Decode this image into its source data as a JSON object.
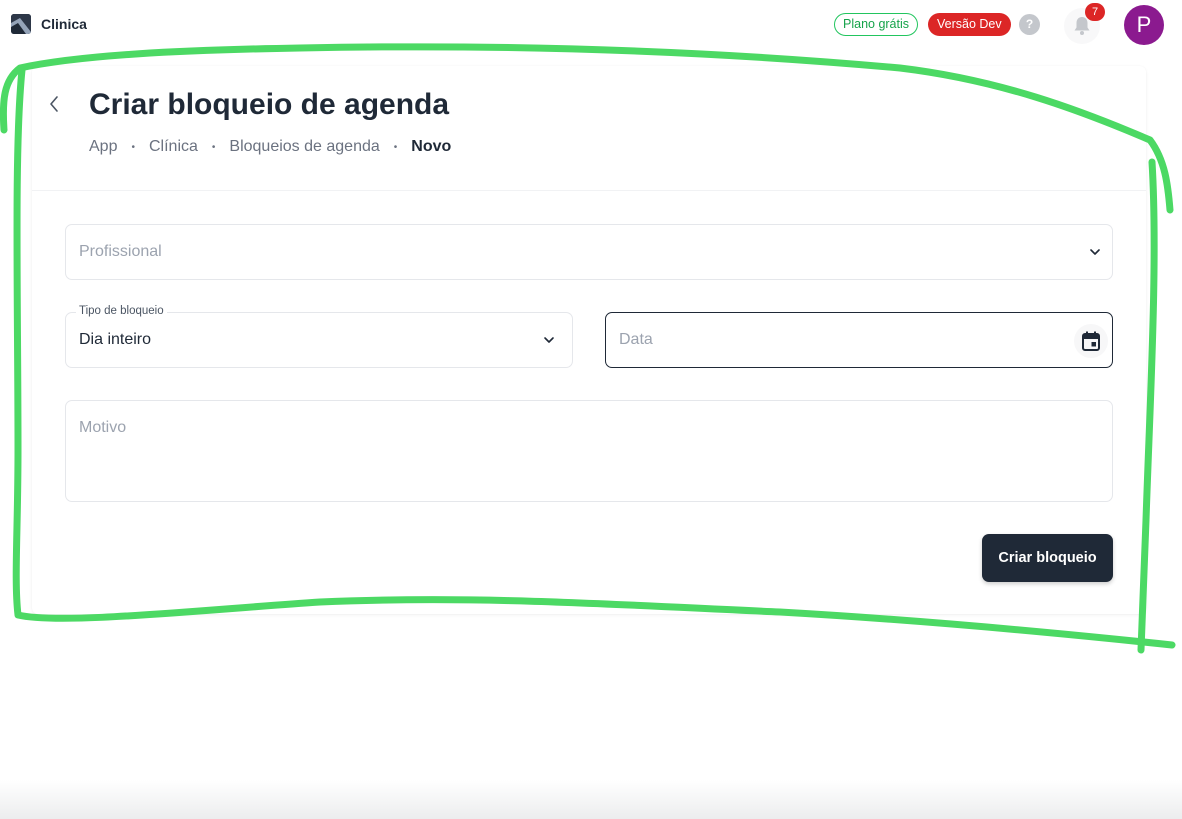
{
  "app": {
    "name": "Clinica"
  },
  "header": {
    "plan_badge": "Plano grátis",
    "env_badge": "Versão Dev",
    "help_glyph": "?",
    "notification_count": "7",
    "avatar_initial": "P"
  },
  "page": {
    "title": "Criar bloqueio de agenda",
    "breadcrumb": [
      "App",
      "Clínica",
      "Bloqueios de agenda",
      "Novo"
    ]
  },
  "form": {
    "professional": {
      "placeholder": "Profissional"
    },
    "block_type": {
      "label": "Tipo de bloqueio",
      "value": "Dia inteiro"
    },
    "date": {
      "placeholder": "Data"
    },
    "reason": {
      "placeholder": "Motivo"
    },
    "submit_label": "Criar bloqueio"
  },
  "icons": {
    "logo": "app-logo-icon",
    "back": "chevron-left-icon",
    "help": "help-icon",
    "notifications": "bell-icon",
    "select": "chevron-down-icon",
    "calendar": "calendar-icon"
  },
  "colors": {
    "primary": "#1f2937",
    "plan_badge": "#16a34a",
    "dev_badge": "#dc2626",
    "avatar": "#8b1a8f",
    "annotation": "#4cd964"
  }
}
